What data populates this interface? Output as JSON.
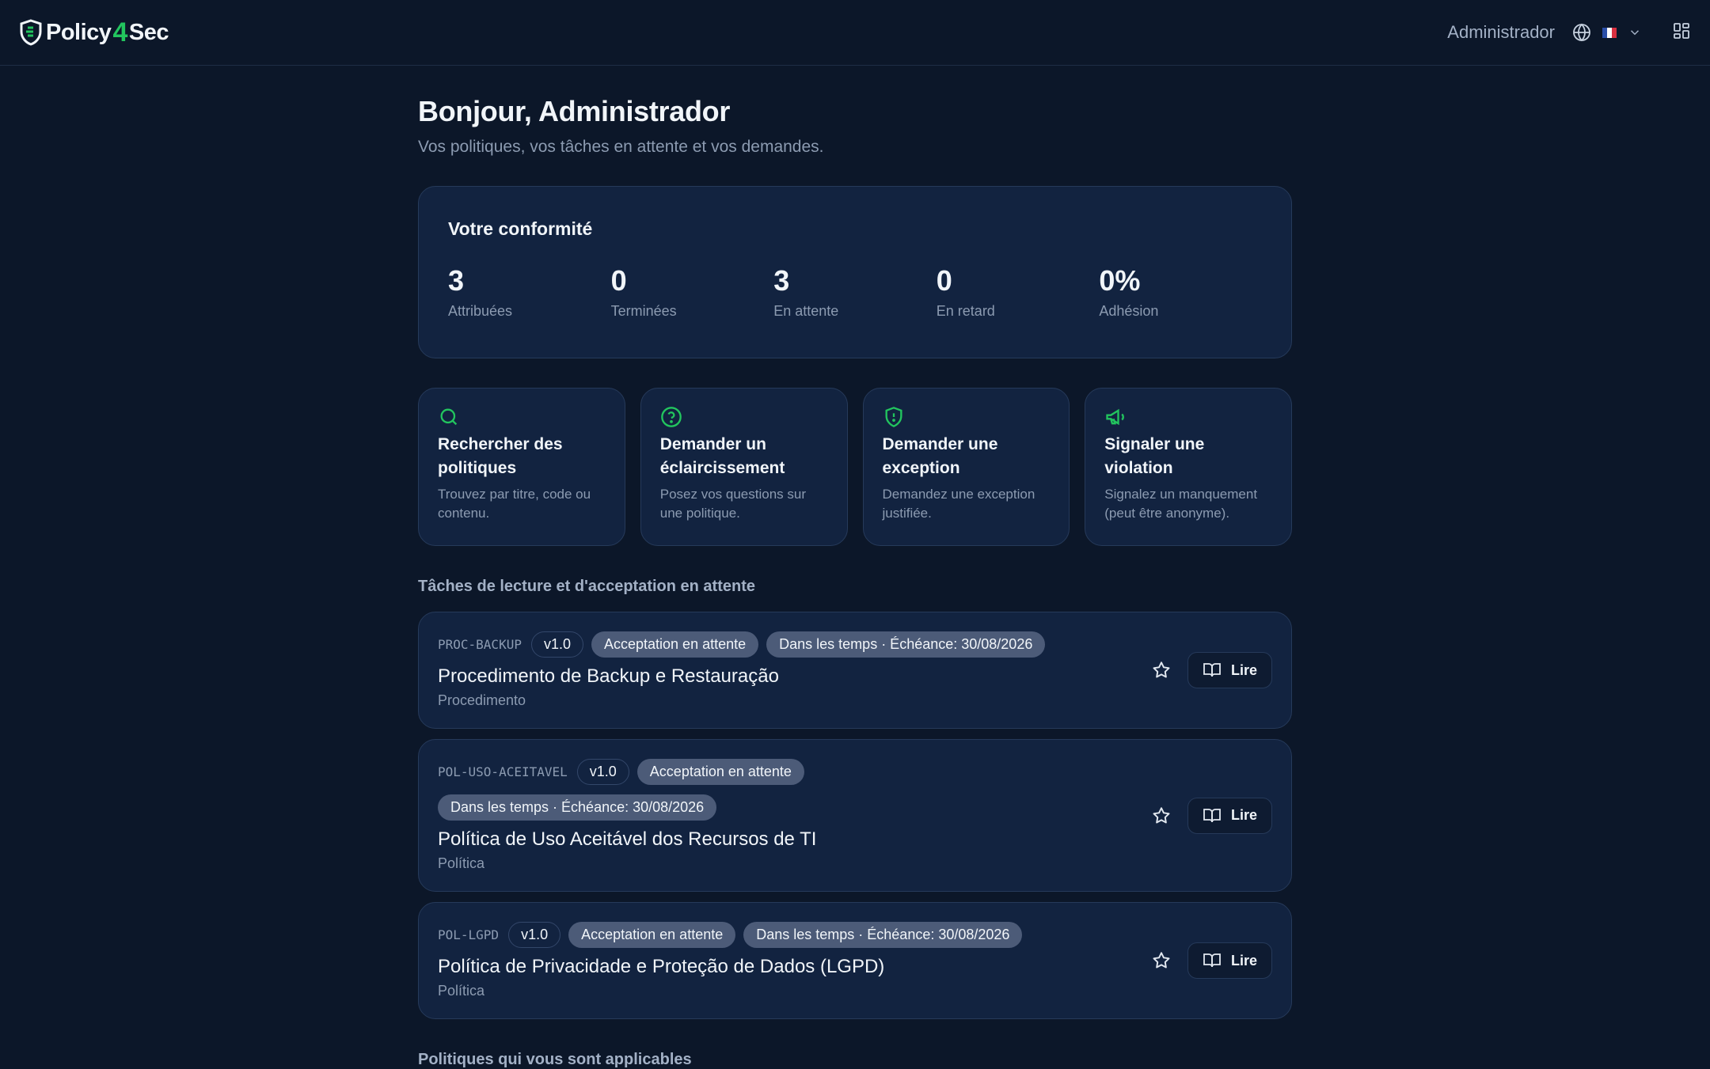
{
  "header": {
    "logo_left": "Policy",
    "logo_mid": "4",
    "logo_right": "Sec",
    "user": "Administrador"
  },
  "greeting": {
    "title": "Bonjour, Administrador",
    "subtitle": "Vos politiques, vos tâches en attente et vos demandes."
  },
  "compliance": {
    "title": "Votre conformité",
    "stats": [
      {
        "value": "3",
        "label": "Attribuées"
      },
      {
        "value": "0",
        "label": "Terminées"
      },
      {
        "value": "3",
        "label": "En attente"
      },
      {
        "value": "0",
        "label": "En retard"
      },
      {
        "value": "0%",
        "label": "Adhésion"
      }
    ]
  },
  "actions": [
    {
      "icon": "search-icon",
      "title": "Rechercher des politiques",
      "desc": "Trouvez par titre, code ou contenu."
    },
    {
      "icon": "help-circle-icon",
      "title": "Demander un éclaircissement",
      "desc": "Posez vos questions sur une politique."
    },
    {
      "icon": "shield-alert-icon",
      "title": "Demander une exception",
      "desc": "Demandez une exception justifiée."
    },
    {
      "icon": "megaphone-icon",
      "title": "Signaler une violation",
      "desc": "Signalez un manquement (peut être anonyme)."
    }
  ],
  "tasks_section": {
    "title": "Tâches de lecture et d'acceptation en attente",
    "read_label": "Lire"
  },
  "tasks": [
    {
      "code": "PROC-BACKUP",
      "version": "v1.0",
      "status": "Acceptation en attente",
      "deadline": "Dans les temps · Échéance: 30/08/2026",
      "title": "Procedimento de Backup e Restauração",
      "type": "Procedimento"
    },
    {
      "code": "POL-USO-ACEITAVEL",
      "version": "v1.0",
      "status": "Acceptation en attente",
      "deadline": "Dans les temps · Échéance: 30/08/2026",
      "title": "Política de Uso Aceitável dos Recursos de TI",
      "type": "Política"
    },
    {
      "code": "POL-LGPD",
      "version": "v1.0",
      "status": "Acceptation en attente",
      "deadline": "Dans les temps · Échéance: 30/08/2026",
      "title": "Política de Privacidade e Proteção de Dados (LGPD)",
      "type": "Política"
    }
  ],
  "next_section": {
    "title": "Politiques qui vous sont applicables"
  },
  "colors": {
    "background": "#0c1729",
    "card": "#122340",
    "accent": "#22c55e",
    "pill": "#4c5b78"
  }
}
